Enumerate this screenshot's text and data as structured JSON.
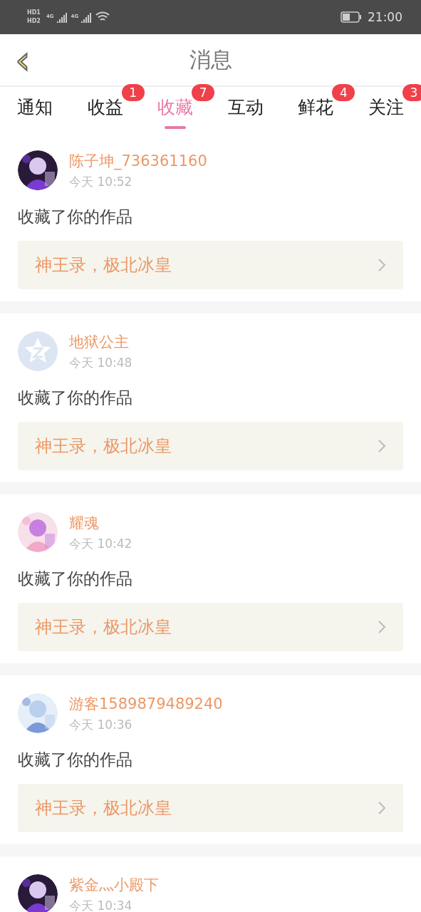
{
  "status_bar": {
    "sims": [
      {
        "hd": "HD",
        "slot": "1",
        "net": "4G"
      },
      {
        "hd": "HD",
        "slot": "2",
        "net": "4G"
      }
    ],
    "time": "21:00"
  },
  "header": {
    "back": "‹",
    "title": "消息"
  },
  "tabs": [
    {
      "label": "通知",
      "selected": false
    },
    {
      "label": "收益",
      "selected": false,
      "badge": "1"
    },
    {
      "label": "收藏",
      "selected": true,
      "badge": "7"
    },
    {
      "label": "互动",
      "selected": false
    },
    {
      "label": "鲜花",
      "selected": false,
      "badge": "4"
    },
    {
      "label": "关注",
      "selected": false,
      "badge": "3"
    }
  ],
  "messages": [
    {
      "name": "陈子坤_736361160",
      "time": "今天 10:52",
      "action": "收藏了你的作品",
      "work": "神王录，极北冰皇"
    },
    {
      "avatar": {
        "kind": "default"
      },
      "name": "地狱公主",
      "time": "今天 10:48",
      "action": "收藏了你的作品",
      "work": "神王录，极北冰皇"
    },
    {
      "name": "耀魂",
      "time": "今天 10:42",
      "action": "收藏了你的作品",
      "work": "神王录，极北冰皇"
    },
    {
      "name": "游客1589879489240",
      "time": "今天 10:36",
      "action": "收藏了你的作品",
      "work": "神王录，极北冰皇"
    },
    {
      "name": "紫金灬小殿下",
      "time": "今天 10:34"
    }
  ]
}
